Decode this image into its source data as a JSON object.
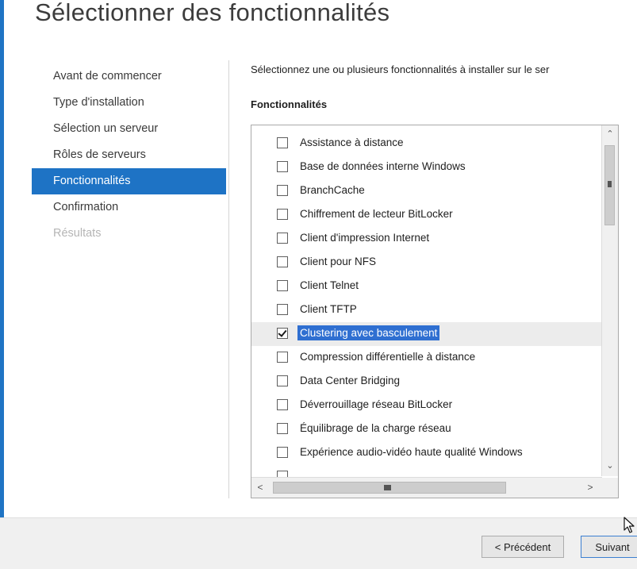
{
  "page_title": "Sélectionner des fonctionnalités",
  "nav": {
    "items": [
      {
        "label": "Avant de commencer",
        "state": "normal"
      },
      {
        "label": "Type d'installation",
        "state": "normal"
      },
      {
        "label": "Sélection un serveur",
        "state": "normal"
      },
      {
        "label": "Rôles de serveurs",
        "state": "normal"
      },
      {
        "label": "Fonctionnalités",
        "state": "active"
      },
      {
        "label": "Confirmation",
        "state": "normal"
      },
      {
        "label": "Résultats",
        "state": "disabled"
      }
    ]
  },
  "main": {
    "description": "Sélectionnez une ou plusieurs fonctionnalités à installer sur le ser",
    "section_label": "Fonctionnalités",
    "features": [
      {
        "label": "Assistance à distance",
        "checked": false,
        "selected": false
      },
      {
        "label": "Base de données interne Windows",
        "checked": false,
        "selected": false
      },
      {
        "label": "BranchCache",
        "checked": false,
        "selected": false
      },
      {
        "label": "Chiffrement de lecteur BitLocker",
        "checked": false,
        "selected": false
      },
      {
        "label": "Client d'impression Internet",
        "checked": false,
        "selected": false
      },
      {
        "label": "Client pour NFS",
        "checked": false,
        "selected": false
      },
      {
        "label": "Client Telnet",
        "checked": false,
        "selected": false
      },
      {
        "label": "Client TFTP",
        "checked": false,
        "selected": false
      },
      {
        "label": "Clustering avec basculement",
        "checked": true,
        "selected": true
      },
      {
        "label": "Compression différentielle à distance",
        "checked": false,
        "selected": false
      },
      {
        "label": "Data Center Bridging",
        "checked": false,
        "selected": false
      },
      {
        "label": "Déverrouillage réseau BitLocker",
        "checked": false,
        "selected": false
      },
      {
        "label": "Équilibrage de la charge réseau",
        "checked": false,
        "selected": false
      },
      {
        "label": "Expérience audio-vidéo haute qualité Windows",
        "checked": false,
        "selected": false
      },
      {
        "label": "",
        "checked": false,
        "selected": false
      }
    ]
  },
  "scroll": {
    "up_arrow": "⌃",
    "down_arrow": "⌄",
    "left_arrow": "<",
    "right_arrow": ">"
  },
  "footer": {
    "prev_label": "< Précédent",
    "next_label": "Suivant"
  },
  "colors": {
    "accent": "#1e73c5",
    "selection": "#2f6fd1",
    "footer_bg": "#f0f0f0"
  },
  "icons": {
    "cursor": "arrow-cursor-icon",
    "checkbox": "checkbox-icon"
  }
}
